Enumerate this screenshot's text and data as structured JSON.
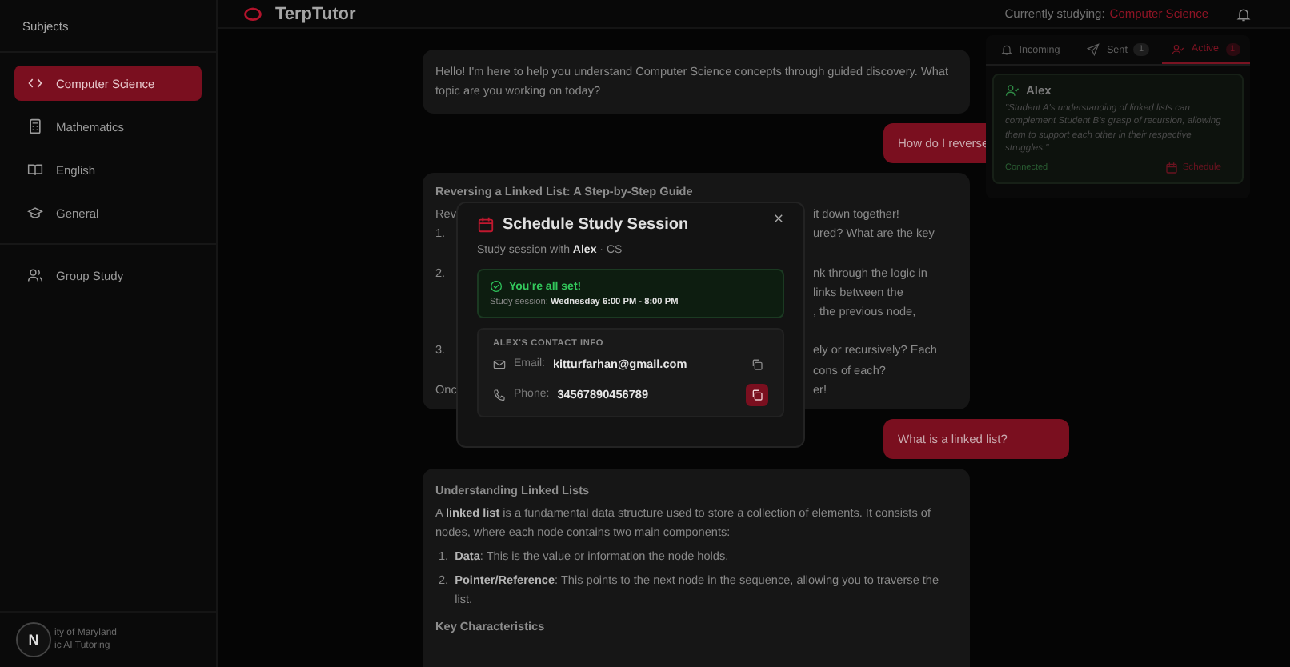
{
  "sidebar": {
    "heading": "Subjects",
    "items": [
      {
        "label": "Computer Science",
        "selected": true
      },
      {
        "label": "Mathematics",
        "selected": false
      },
      {
        "label": "English",
        "selected": false
      },
      {
        "label": "General",
        "selected": false
      }
    ],
    "group_item": {
      "label": "Group Study",
      "selected": false
    },
    "footer": {
      "badge": "N",
      "lines": [
        "ity of Maryland",
        "ic AI Tutoring"
      ]
    }
  },
  "header": {
    "title": "TerpTutor",
    "studying_label": "Currently studying:",
    "studying_value": "Computer Science"
  },
  "chat": [
    {
      "kind": "bot",
      "paragraphs": [
        "Hello! I'm here to help you understand Computer Science concepts through guided discovery. What topic are you working on today?"
      ]
    },
    {
      "kind": "user",
      "text": "How do I reverse"
    },
    {
      "kind": "partial",
      "title": "Reversing a Linked List: A Step-by-Step Guide",
      "rows": [
        [
          "Rev",
          "it down together!"
        ],
        [
          "1.",
          "ured? What are the key"
        ],
        [
          "",
          ""
        ],
        [
          "2.",
          "nk through the logic in"
        ],
        [
          "",
          "links between the"
        ],
        [
          "",
          ", the previous node,"
        ],
        [
          "",
          ""
        ],
        [
          "3.",
          "ely or recursively? Each"
        ],
        [
          "",
          "cons of each?"
        ],
        [
          "Onc",
          "er!"
        ]
      ]
    },
    {
      "kind": "user",
      "text": "What is a linked list?"
    },
    {
      "kind": "bot",
      "title": "Understanding Linked Lists",
      "paragraphs": [
        "A **linked list** is a fundamental data structure used to store a collection of elements. It consists of nodes, where each node contains two main components:"
      ],
      "list": [
        {
          "number": "1.",
          "text": "**Data**: This is the value or information the node holds."
        },
        {
          "number": "2.",
          "text": "**Pointer/Reference**: This points to the next node in the sequence, allowing you to traverse the list."
        }
      ],
      "subtitle": "Key Characteristics"
    }
  ],
  "panel": {
    "tabs": [
      {
        "label": "Incoming",
        "selected": false
      },
      {
        "label": "Sent",
        "count": "1",
        "selected": false
      },
      {
        "label": "Active",
        "count": "1",
        "selected": true
      }
    ],
    "match": {
      "name": "Alex",
      "quote": "\"Student A's understanding of linked lists can complement Student B's grasp of recursion, allowing them to support each other in their respective struggles.\"",
      "status": "Connected",
      "action": "Schedule"
    }
  },
  "modal": {
    "title": "Schedule Study Session",
    "subtitle": "Study session with **Alex** · CS",
    "success": {
      "title": "You're all set!",
      "detail": "Study session: **Wednesday 6:00 PM - 8:00 PM**"
    },
    "contact": {
      "heading": "ALEX'S CONTACT INFO",
      "rows": [
        {
          "kind": "email",
          "label": "Email:",
          "value": "kitturfarhan@gmail.com",
          "active": false
        },
        {
          "kind": "phone",
          "label": "Phone:",
          "value": "34567890456789",
          "active": true
        }
      ]
    }
  }
}
